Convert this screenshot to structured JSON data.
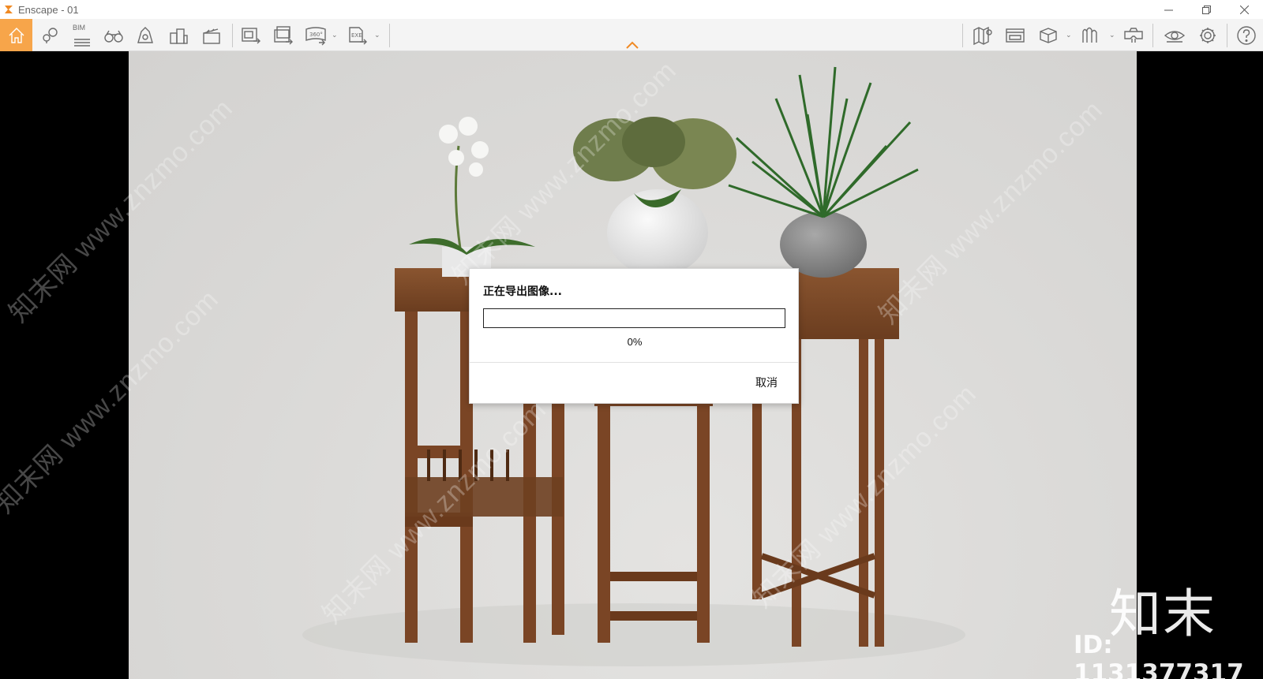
{
  "window": {
    "title": "Enscape - 01"
  },
  "toolbar": {
    "bim_label": "BIM",
    "screenshot_360_label": "360°",
    "exe_label": "EXE"
  },
  "dialog": {
    "title": "正在导出图像...",
    "progress": 0,
    "progress_text": "0%",
    "cancel_label": "取消"
  },
  "watermark": {
    "text": "知末网 www.znzmo.com",
    "brand": "知末",
    "id": "ID: 1131377317"
  },
  "colors": {
    "accent": "#f7a54a",
    "toolbar_bg": "#f4f4f4",
    "scene_bg": "#dcdbd9"
  }
}
